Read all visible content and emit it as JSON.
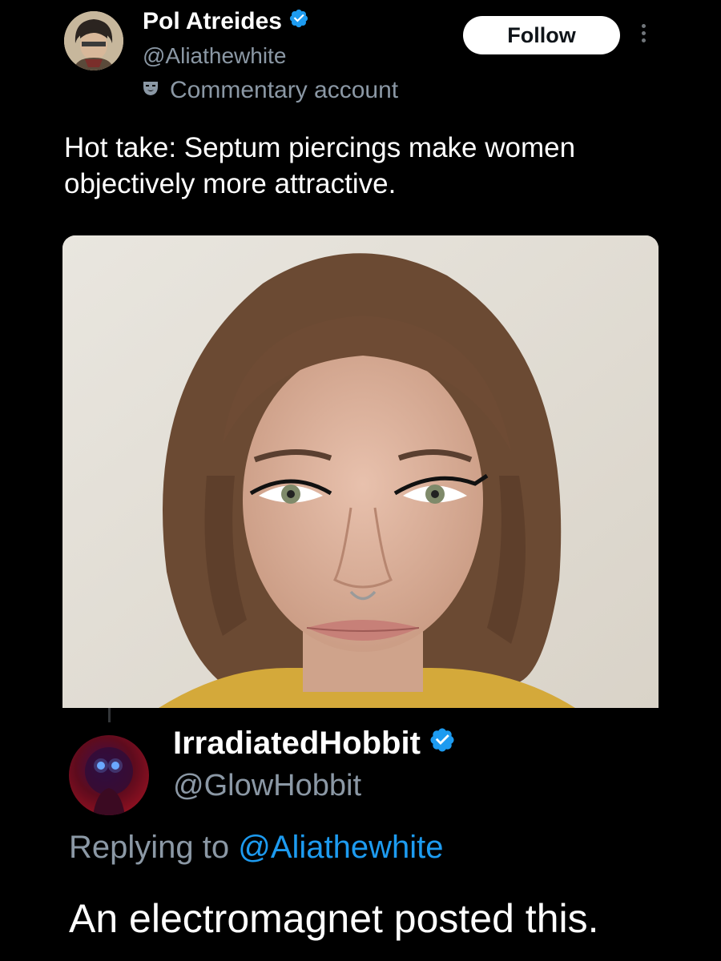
{
  "tweet": {
    "author": {
      "name": "Pol Atreides",
      "handle": "@Aliathewhite",
      "label": "Commentary account",
      "verified": true
    },
    "follow_label": "Follow",
    "text": "Hot take: Septum piercings make women objectively more attractive.",
    "media": {
      "type": "photo",
      "subject": "portrait of a woman with a septum piercing"
    }
  },
  "reply": {
    "author": {
      "name": "IrradiatedHobbit",
      "handle": "@GlowHobbit",
      "verified": true
    },
    "replying_prefix": "Replying to",
    "replying_to": "@Aliathewhite",
    "text": "An electromagnet posted this."
  },
  "colors": {
    "background": "#000000",
    "text_primary": "#e7e9ea",
    "text_secondary": "#8b98a5",
    "accent": "#1d9bf0"
  },
  "icons": [
    "verified-badge-icon",
    "commentary-mask-icon",
    "more-options-icon"
  ]
}
